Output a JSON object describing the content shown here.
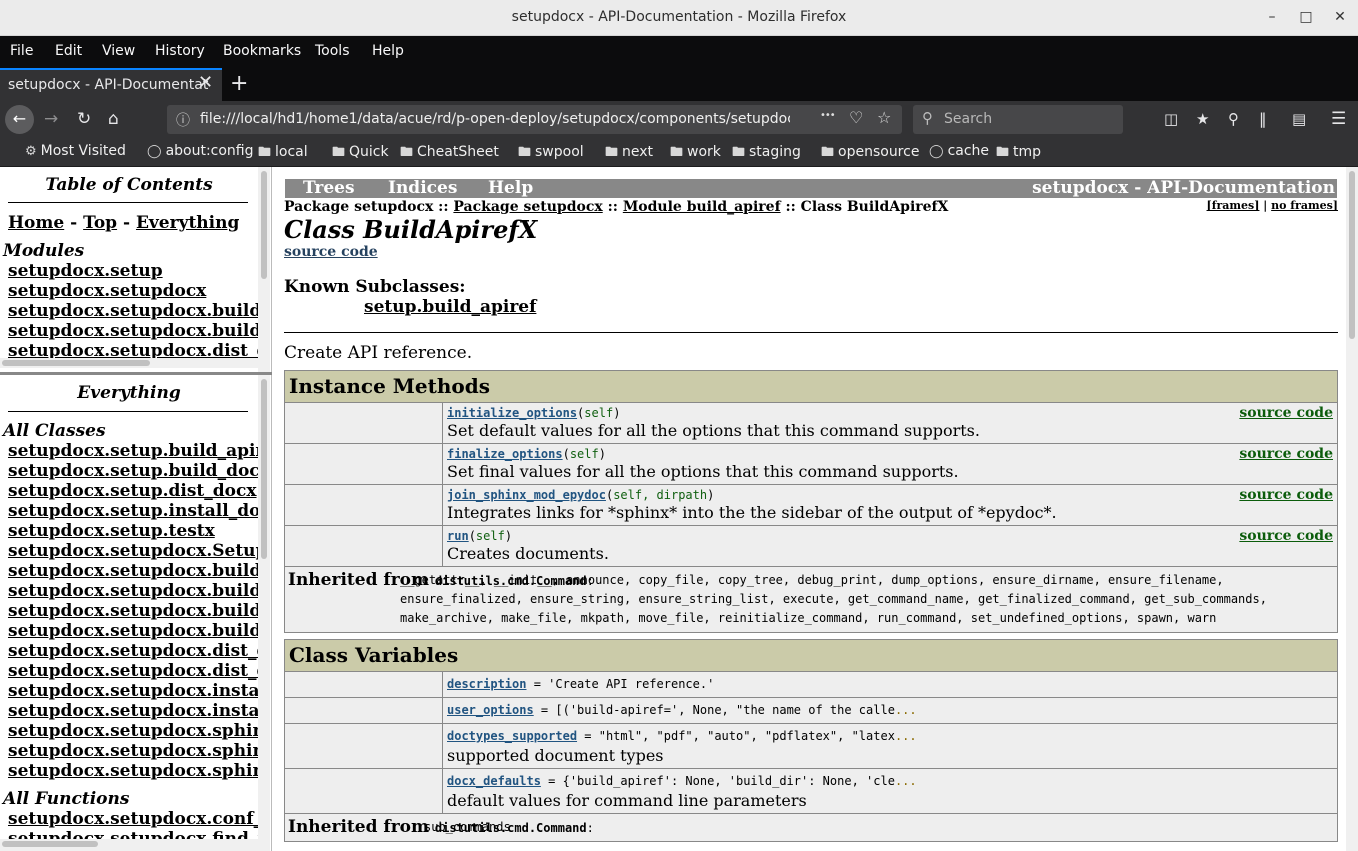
{
  "window": {
    "title": "setupdocx - API-Documentation - Mozilla Firefox",
    "minimize": "–",
    "maximize": "□",
    "close": "✕"
  },
  "menu": [
    "File",
    "Edit",
    "View",
    "History",
    "Bookmarks",
    "Tools",
    "Help"
  ],
  "tab": {
    "title": "setupdocx - API-Documentat",
    "close": "✕",
    "new": "+"
  },
  "nav": {
    "url": "file:///local/hd1/home1/data/acue/rd/p-open-deploy/setupdocx/components/setupdocx/buil",
    "search_placeholder": "Search",
    "more": "•••"
  },
  "bookmarks": [
    "Most Visited",
    "about:config",
    "local",
    "Quick",
    "CheatSheet",
    "swpool",
    "next",
    "work",
    "staging",
    "opensource",
    "cache",
    "tmp"
  ],
  "toc": {
    "title": "Table of Contents",
    "nav": {
      "home": "Home",
      "top": "Top",
      "everything": "Everything",
      "sep": "-"
    },
    "modules_heading": "Modules",
    "modules": [
      "setupdocx.setup",
      "setupdocx.setupdocx",
      "setupdocx.setupdocx.build_apiref",
      "setupdocx.setupdocx.build_docx",
      "setupdocx.setupdocx.dist_docx"
    ]
  },
  "everything": {
    "title": "Everything",
    "classes_heading": "All Classes",
    "classes": [
      "setupdocx.setup.build_apiref",
      "setupdocx.setup.build_docx",
      "setupdocx.setup.dist_docx",
      "setupdocx.setup.install_docx",
      "setupdocx.setup.testx",
      "setupdocx.setupdocx.SetupDocX",
      "setupdocx.setupdocx.build_apiref",
      "setupdocx.setupdocx.build_apiref",
      "setupdocx.setupdocx.build_docx",
      "setupdocx.setupdocx.build_docx",
      "setupdocx.setupdocx.dist_docx",
      "setupdocx.setupdocx.dist_docx",
      "setupdocx.setupdocx.install_docx",
      "setupdocx.setupdocx.install_docx",
      "setupdocx.setupdocx.sphinx",
      "setupdocx.setupdocx.sphinx",
      "setupdocx.setupdocx.sphinx"
    ],
    "functions_heading": "All Functions",
    "functions": [
      "setupdocx.setupdocx.conf_list",
      "setupdocx.setupdocx.find_files"
    ]
  },
  "doc": {
    "navbar": {
      "trees": "Trees",
      "indices": "Indices",
      "help": "Help",
      "project": "setupdocx - API-Documentation"
    },
    "crumbs": {
      "p1": "Package setupdocx ::",
      "p2": "Package setupdocx",
      "sep1": "::",
      "p3": "Module build_apiref",
      "sep2": ":: Class BuildApirefX"
    },
    "frames": {
      "frames": "[frames]",
      "sep": "|",
      "noframes": "no frames]"
    },
    "class_title": "Class BuildApirefX",
    "source_code": "source code",
    "subclasses_heading": "Known Subclasses:",
    "subclass": "setup.build_apiref",
    "description": "Create API reference.",
    "instance_methods": {
      "heading": "Instance Methods",
      "rows": [
        {
          "name": "initialize_options",
          "args": "self",
          "desc": "Set default values for all the options that this command supports.",
          "src": "source code"
        },
        {
          "name": "finalize_options",
          "args": "self",
          "desc": "Set final values for all the options that this command supports.",
          "src": "source code"
        },
        {
          "name": "join_sphinx_mod_epydoc",
          "args": "self, dirpath",
          "desc": "Integrates links for *sphinx* into the the sidebar of the output of *epydoc*.",
          "src": "source code"
        },
        {
          "name": "run",
          "args": "self",
          "desc": "Creates documents.",
          "src": "source code"
        }
      ],
      "inherited_label": "Inherited from",
      "inherited_from": "distutils.cmd.Command",
      "inherited_list": "__getattr__, __init__, announce, copy_file, copy_tree, debug_print, dump_options, ensure_dirname, ensure_filename, ensure_finalized, ensure_string, ensure_string_list, execute, get_command_name, get_finalized_command, get_sub_commands, make_archive, make_file, mkpath, move_file, reinitialize_command, run_command, set_undefined_options, spawn, warn"
    },
    "class_variables": {
      "heading": "Class Variables",
      "rows": [
        {
          "name": "description",
          "value": " = 'Create API reference.'",
          "ellipsis": "",
          "desc": ""
        },
        {
          "name": "user_options",
          "value": " = [('build-apiref=', None, \"the name of the calle",
          "ellipsis": "...",
          "desc": ""
        },
        {
          "name": "doctypes_supported",
          "value": " = \"html\", \"pdf\", \"auto\", \"pdflatex\", \"latex",
          "ellipsis": "...",
          "desc": "supported document types"
        },
        {
          "name": "docx_defaults",
          "value": " = {'build_apiref': None, 'build_dir': None, 'cle",
          "ellipsis": "...",
          "desc": "default values for command line parameters"
        }
      ],
      "inherited_label": "Inherited from",
      "inherited_from": "distutils.cmd.Command",
      "inherited_list": "sub_commands"
    }
  }
}
